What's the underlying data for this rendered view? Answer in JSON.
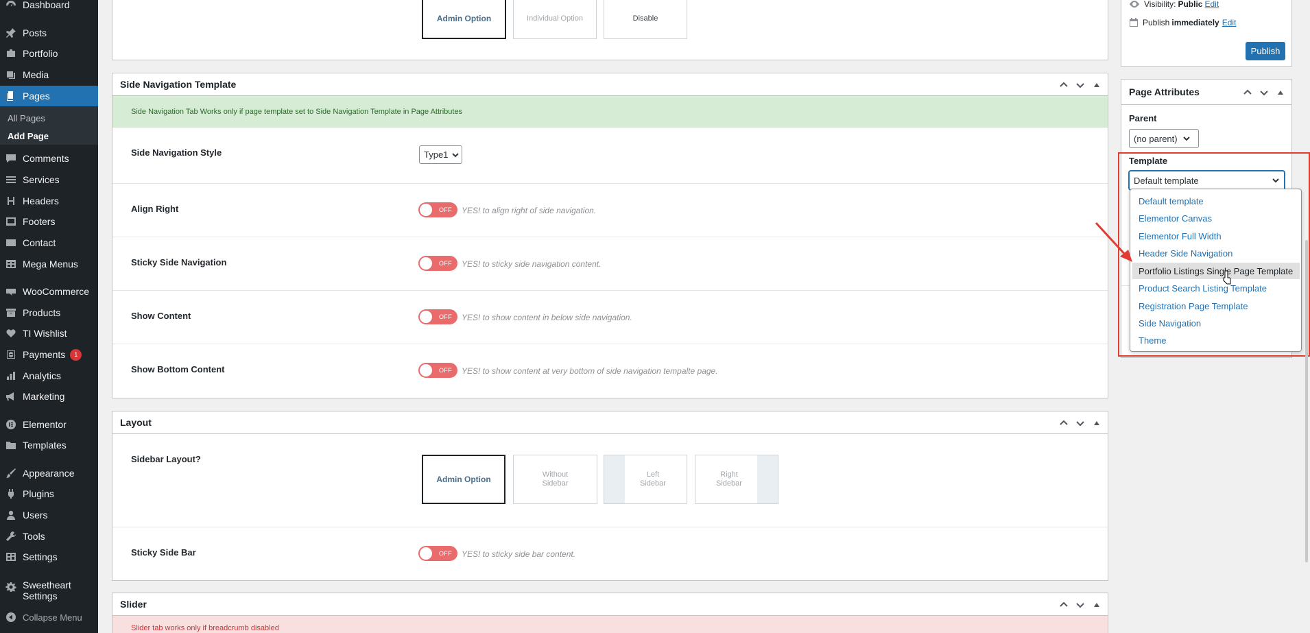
{
  "sidebar": {
    "items": [
      {
        "label": "Dashboard",
        "icon": "dashboard-icon"
      },
      {
        "label": "Posts",
        "icon": "pin-icon"
      },
      {
        "label": "Portfolio",
        "icon": "portfolio-icon"
      },
      {
        "label": "Media",
        "icon": "media-icon"
      },
      {
        "label": "Pages",
        "icon": "pages-icon"
      },
      {
        "label": "Comments",
        "icon": "comments-icon"
      },
      {
        "label": "Services",
        "icon": "list-icon"
      },
      {
        "label": "Headers",
        "icon": "heading-icon"
      },
      {
        "label": "Footers",
        "icon": "footer-icon"
      },
      {
        "label": "Contact",
        "icon": "mail-icon"
      },
      {
        "label": "Mega Menus",
        "icon": "table-icon"
      },
      {
        "label": "WooCommerce",
        "icon": "woo-icon"
      },
      {
        "label": "Products",
        "icon": "archive-icon"
      },
      {
        "label": "TI Wishlist",
        "icon": "heart-icon"
      },
      {
        "label": "Payments",
        "icon": "dollar-icon",
        "badge": "1"
      },
      {
        "label": "Analytics",
        "icon": "chart-icon"
      },
      {
        "label": "Marketing",
        "icon": "megaphone-icon"
      },
      {
        "label": "Elementor",
        "icon": "elementor-icon"
      },
      {
        "label": "Templates",
        "icon": "folder-icon"
      },
      {
        "label": "Appearance",
        "icon": "brush-icon"
      },
      {
        "label": "Plugins",
        "icon": "plug-icon"
      },
      {
        "label": "Users",
        "icon": "user-icon"
      },
      {
        "label": "Tools",
        "icon": "wrench-icon"
      },
      {
        "label": "Settings",
        "icon": "settings-icon"
      },
      {
        "label": "Sweetheart Settings",
        "icon": "gear-icon"
      }
    ],
    "submenu": [
      "All Pages",
      "Add Page"
    ],
    "collapse_label": "Collapse Menu"
  },
  "top_box": {
    "options": [
      "Admin Option",
      "Individual Option",
      "Disable"
    ]
  },
  "side_nav": {
    "title": "Side Navigation Template",
    "notice": "Side Navigation Tab Works only if page template set to Side Navigation Template in Page Attributes",
    "style_label": "Side Navigation Style",
    "style_value": "Type1",
    "toggle_off": "OFF",
    "rows": [
      {
        "label": "Align Right",
        "desc": "YES! to align right of side navigation."
      },
      {
        "label": "Sticky Side Navigation",
        "desc": "YES! to sticky side navigation content."
      },
      {
        "label": "Show Content",
        "desc": "YES! to show content in below side navigation."
      },
      {
        "label": "Show Bottom Content",
        "desc": "YES! to show content at very bottom of side navigation tempalte page."
      }
    ]
  },
  "layout": {
    "title": "Layout",
    "sidebar_label": "Sidebar Layout?",
    "options": [
      "Admin Option",
      "Without Sidebar",
      "Left Sidebar",
      "Right Sidebar"
    ],
    "sticky_label": "Sticky Side Bar",
    "sticky_desc": "YES! to sticky side bar content."
  },
  "slider": {
    "title": "Slider",
    "notice": "Slider tab works only if breadcrumb disabled"
  },
  "publish": {
    "visibility_prefix": "Visibility: ",
    "visibility_value": "Public",
    "edit_label": "Edit",
    "publish_prefix": "Publish ",
    "publish_value": "immediately",
    "button": "Publish"
  },
  "page_attributes": {
    "title": "Page Attributes",
    "parent_label": "Parent",
    "parent_value": "(no parent)",
    "template_label": "Template",
    "template_value": "Default template",
    "template_options": [
      "Default template",
      "Elementor Canvas",
      "Elementor Full Width",
      "Header Side Navigation",
      "Portfolio Listings Single Page Template",
      "Product Search Listing Template",
      "Registration Page Template",
      "Side Navigation",
      "Theme"
    ],
    "hovered_option": "Portfolio Listings Single Page Template"
  },
  "colors": {
    "sidebar_bg": "#1d2327",
    "accent": "#2271b1",
    "toggle_off": "#e96b6b",
    "annotation": "#e03c32"
  }
}
